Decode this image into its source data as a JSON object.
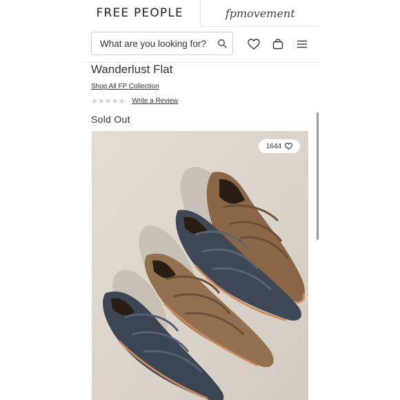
{
  "header": {
    "brand_left": "FREE PEOPLE",
    "brand_right": "fpmovement"
  },
  "search": {
    "placeholder": "What are you looking for?"
  },
  "icons": {
    "search": "search-icon",
    "wishlist": "heart-icon",
    "bag": "shopping-bag-icon",
    "menu": "hamburger-menu-icon"
  },
  "product": {
    "title": "Wanderlust Flat",
    "collection_link": "Shop All FP Collection",
    "rating_stars": "★★★★★",
    "rating_value": 0,
    "review_link": "Write a Review",
    "status": "Sold Out",
    "likes": "1644"
  },
  "colors": {
    "leather_navy": "#3d4653",
    "leather_brown": "#8f6a4a",
    "sole_tan": "#c98a5c",
    "background_stone": "#dcd5cc"
  }
}
